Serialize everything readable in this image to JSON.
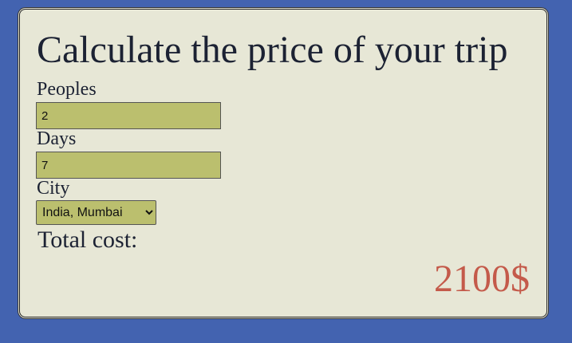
{
  "form": {
    "title": "Calculate the price of your trip",
    "peoples": {
      "label": "Peoples",
      "value": "2"
    },
    "days": {
      "label": "Days",
      "value": "7"
    },
    "city": {
      "label": "City",
      "selected": "India, Mumbai"
    },
    "total": {
      "label": "Total cost:",
      "value": "2100$"
    }
  },
  "colors": {
    "background": "#4363b0",
    "card": "#e7e7d6",
    "input": "#bbbf6e",
    "total_value": "#c45a4a"
  }
}
